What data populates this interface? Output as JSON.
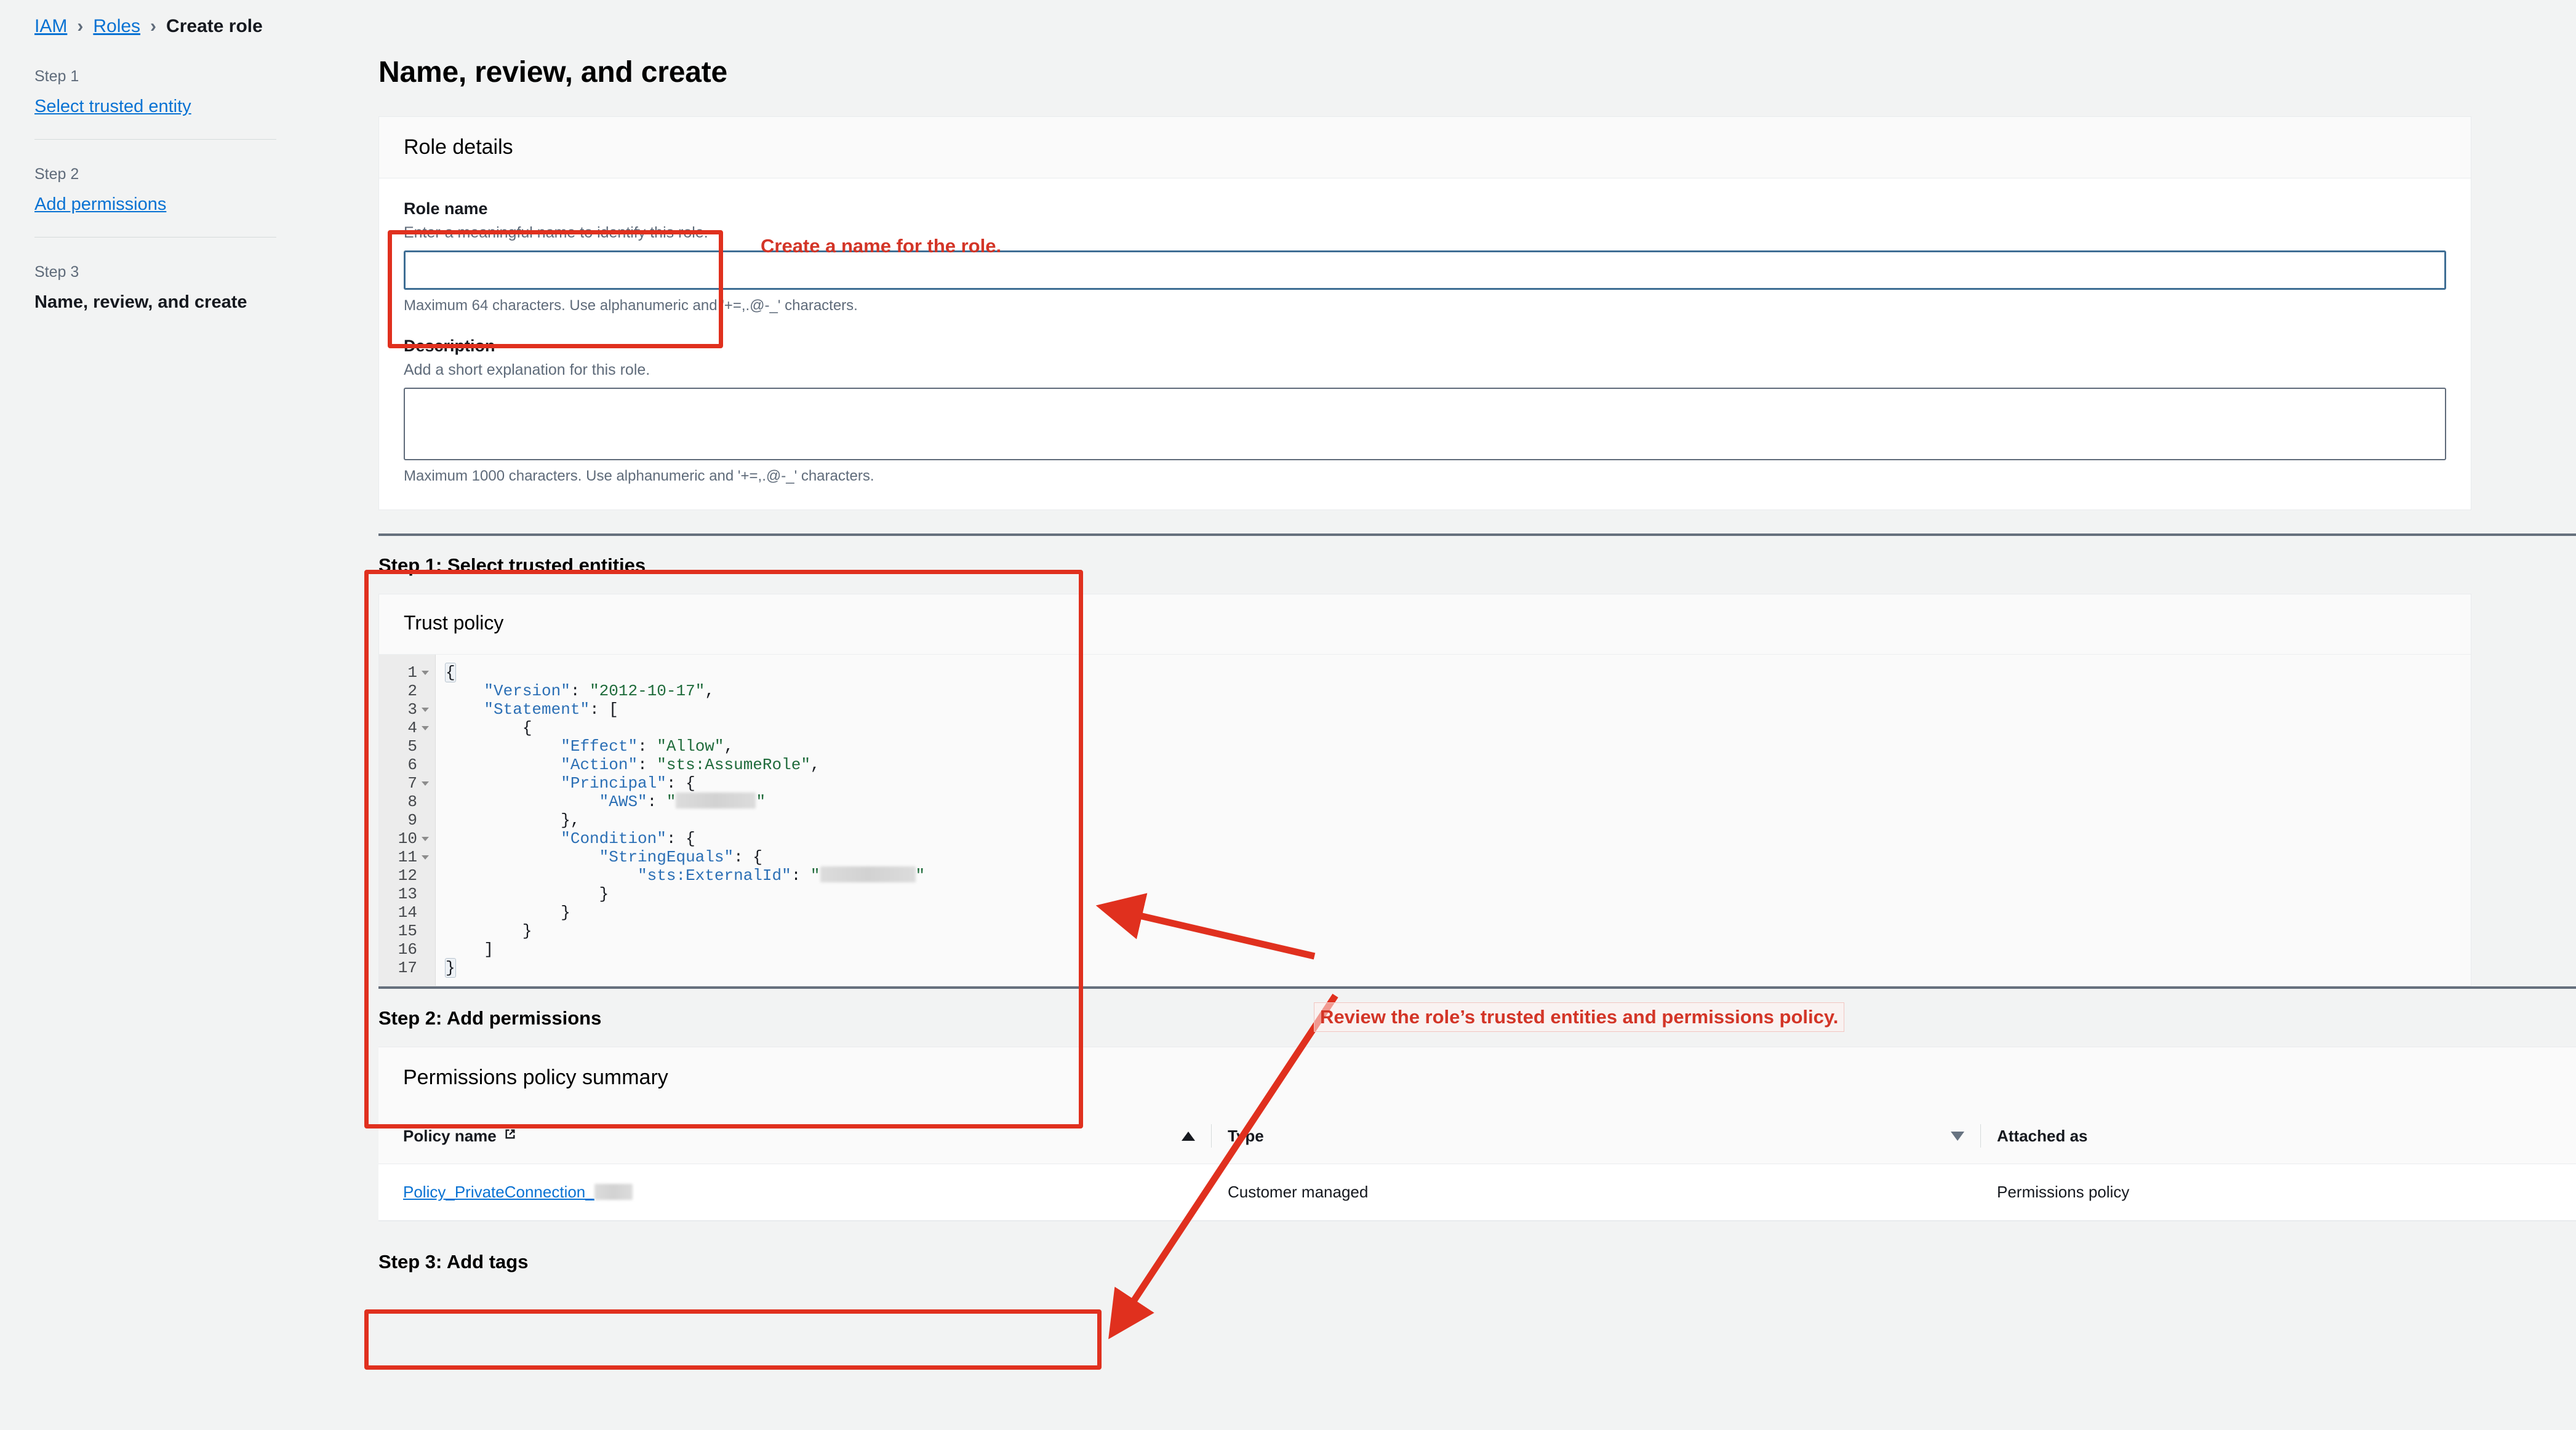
{
  "breadcrumb": {
    "items": [
      {
        "label": "IAM",
        "link": true
      },
      {
        "label": "Roles",
        "link": true
      },
      {
        "label": "Create role",
        "link": false
      }
    ],
    "separator": "›"
  },
  "steps": [
    {
      "kicker": "Step 1",
      "label": "Select trusted entity",
      "state": "link"
    },
    {
      "kicker": "Step 2",
      "label": "Add permissions",
      "state": "link"
    },
    {
      "kicker": "Step 3",
      "label": "Name, review, and create",
      "state": "current"
    }
  ],
  "page": {
    "title": "Name, review, and create"
  },
  "role_details": {
    "panel_title": "Role details",
    "role_name": {
      "label": "Role name",
      "description": "Enter a meaningful name to identify this role.",
      "value": "",
      "placeholder": "",
      "hint": "Maximum 64 characters. Use alphanumeric and '+=,.@-_' characters."
    },
    "description_field": {
      "label": "Description",
      "description": "Add a short explanation for this role.",
      "value": "",
      "placeholder": "",
      "hint": "Maximum 1000 characters. Use alphanumeric and '+=,.@-_' characters."
    }
  },
  "step1": {
    "heading": "Step 1: Select trusted entities",
    "trust_policy_title": "Trust policy",
    "code_lines": [
      {
        "n": 1,
        "fold": true,
        "tokens": [
          {
            "t": "{",
            "c": "p"
          }
        ]
      },
      {
        "n": 2,
        "fold": false,
        "tokens": [
          {
            "t": "    ",
            "c": "p"
          },
          {
            "t": "\"Version\"",
            "c": "k"
          },
          {
            "t": ": ",
            "c": "p"
          },
          {
            "t": "\"2012-10-17\"",
            "c": "s"
          },
          {
            "t": ",",
            "c": "p"
          }
        ]
      },
      {
        "n": 3,
        "fold": true,
        "tokens": [
          {
            "t": "    ",
            "c": "p"
          },
          {
            "t": "\"Statement\"",
            "c": "k"
          },
          {
            "t": ": [",
            "c": "p"
          }
        ]
      },
      {
        "n": 4,
        "fold": true,
        "tokens": [
          {
            "t": "        {",
            "c": "p"
          }
        ]
      },
      {
        "n": 5,
        "fold": false,
        "tokens": [
          {
            "t": "            ",
            "c": "p"
          },
          {
            "t": "\"Effect\"",
            "c": "k"
          },
          {
            "t": ": ",
            "c": "p"
          },
          {
            "t": "\"Allow\"",
            "c": "s"
          },
          {
            "t": ",",
            "c": "p"
          }
        ]
      },
      {
        "n": 6,
        "fold": false,
        "tokens": [
          {
            "t": "            ",
            "c": "p"
          },
          {
            "t": "\"Action\"",
            "c": "k"
          },
          {
            "t": ": ",
            "c": "p"
          },
          {
            "t": "\"sts:AssumeRole\"",
            "c": "s"
          },
          {
            "t": ",",
            "c": "p"
          }
        ]
      },
      {
        "n": 7,
        "fold": true,
        "tokens": [
          {
            "t": "            ",
            "c": "p"
          },
          {
            "t": "\"Principal\"",
            "c": "k"
          },
          {
            "t": ": {",
            "c": "p"
          }
        ]
      },
      {
        "n": 8,
        "fold": false,
        "tokens": [
          {
            "t": "                ",
            "c": "p"
          },
          {
            "t": "\"AWS\"",
            "c": "k"
          },
          {
            "t": ": ",
            "c": "p"
          },
          {
            "t": "\"",
            "c": "s"
          },
          {
            "t": "",
            "c": "redact",
            "w": 130
          },
          {
            "t": "\"",
            "c": "s"
          }
        ]
      },
      {
        "n": 9,
        "fold": false,
        "tokens": [
          {
            "t": "            },",
            "c": "p"
          }
        ]
      },
      {
        "n": 10,
        "fold": true,
        "tokens": [
          {
            "t": "            ",
            "c": "p"
          },
          {
            "t": "\"Condition\"",
            "c": "k"
          },
          {
            "t": ": {",
            "c": "p"
          }
        ]
      },
      {
        "n": 11,
        "fold": true,
        "tokens": [
          {
            "t": "                ",
            "c": "p"
          },
          {
            "t": "\"StringEquals\"",
            "c": "k"
          },
          {
            "t": ": {",
            "c": "p"
          }
        ]
      },
      {
        "n": 12,
        "fold": false,
        "tokens": [
          {
            "t": "                    ",
            "c": "p"
          },
          {
            "t": "\"sts:ExternalId\"",
            "c": "k"
          },
          {
            "t": ": ",
            "c": "p"
          },
          {
            "t": "\"",
            "c": "s"
          },
          {
            "t": "",
            "c": "redact",
            "w": 155
          },
          {
            "t": "\"",
            "c": "s"
          }
        ]
      },
      {
        "n": 13,
        "fold": false,
        "tokens": [
          {
            "t": "                }",
            "c": "p"
          }
        ]
      },
      {
        "n": 14,
        "fold": false,
        "tokens": [
          {
            "t": "            }",
            "c": "p"
          }
        ]
      },
      {
        "n": 15,
        "fold": false,
        "tokens": [
          {
            "t": "        }",
            "c": "p"
          }
        ]
      },
      {
        "n": 16,
        "fold": false,
        "tokens": [
          {
            "t": "    ]",
            "c": "p"
          }
        ]
      },
      {
        "n": 17,
        "fold": false,
        "tokens": [
          {
            "t": "}",
            "c": "p"
          }
        ]
      }
    ]
  },
  "step2": {
    "heading": "Step 2: Add permissions",
    "table_title": "Permissions policy summary",
    "columns": [
      {
        "label": "Policy name",
        "external_link_icon": true,
        "sort": "asc"
      },
      {
        "label": "Type",
        "external_link_icon": false,
        "sort": "desc"
      },
      {
        "label": "Attached as",
        "external_link_icon": false,
        "sort": "none"
      }
    ],
    "rows": [
      {
        "policy_name": "Policy_PrivateConnection_",
        "policy_name_redacted": true,
        "type": "Customer managed",
        "attached_as": "Permissions policy"
      }
    ]
  },
  "step3": {
    "heading": "Step 3: Add tags"
  },
  "annotations": {
    "role_name_note": "Create a name for the role.",
    "review_note": "Review the role’s trusted entities and permissions policy.",
    "accent_color": "#e0301e",
    "text_color": "#d33527"
  }
}
